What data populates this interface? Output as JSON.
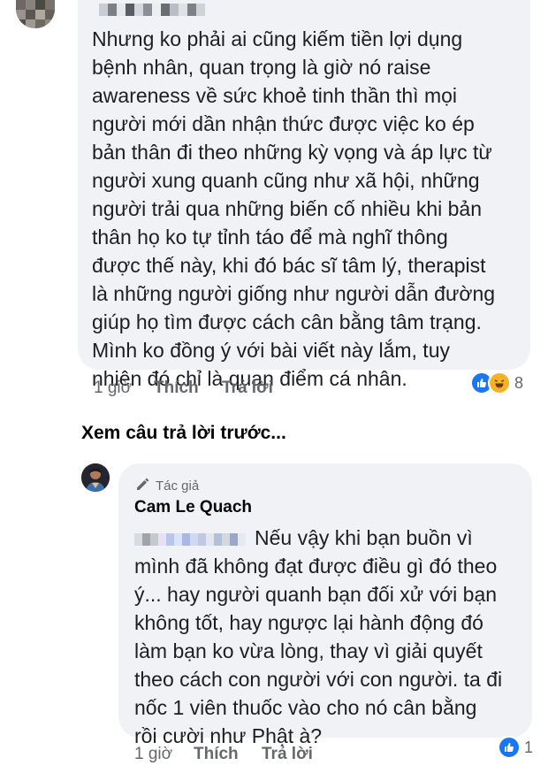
{
  "colors": {
    "bubble_bg": "#f0f2f5",
    "meta_text": "#65676b",
    "like_blue": "#1877f2",
    "haha_yellow": "#f7b125"
  },
  "comment1": {
    "lines": [
      "Nhưng ko phải ai cũng kiếm tiền lợi dụng",
      "bệnh nhân, quan trọng là giờ nó raise",
      "awareness về sức khoẻ tinh thần thì mọi",
      "người mới dần nhận thức được việc ko ép",
      "bản thân đi theo những kỳ vọng và áp lực từ",
      "người xung quanh cũng như xã hội, những",
      "người trải qua những biến cố nhiều khi bản",
      "thân họ ko tự tỉnh táo để mà nghĩ thông",
      "được thế này, khi đó bác sĩ tâm lý, therapist",
      "là những người giống như người dẫn đường",
      "giúp họ tìm được cách cân bằng tâm trạng.",
      "Mình ko đồng ý với bài viết này lắm, tuy",
      "nhiên đó chỉ là quan điểm cá nhân."
    ],
    "time": "1 giờ",
    "like_label": "Thích",
    "reply_label": "Trả lời",
    "reaction_icons": [
      "like-icon",
      "haha-icon"
    ],
    "reaction_count": "8"
  },
  "view_previous": "Xem câu trả lời trước...",
  "comment2": {
    "badge_label": "Tác giả",
    "badge_icon": "pencil-icon",
    "author": "Cam Le Quach",
    "lines": [
      "Nếu vậy khi bạn buồn vì",
      "mình đã không đạt được điều gì đó theo",
      "ý... hay người quanh bạn đối xử với bạn",
      "không tốt, hay ngược lại hành động đó",
      "làm bạn ko vừa lòng, thay vì giải quyết",
      "theo cách con người với con người. ta đi",
      "nốc 1 viên thuốc vào cho nó cân bằng",
      "rồi cười như Phật à?"
    ],
    "time": "1 giờ",
    "like_label": "Thích",
    "reply_label": "Trả lời",
    "reaction_icons": [
      "like-icon"
    ],
    "reaction_count": "1"
  }
}
